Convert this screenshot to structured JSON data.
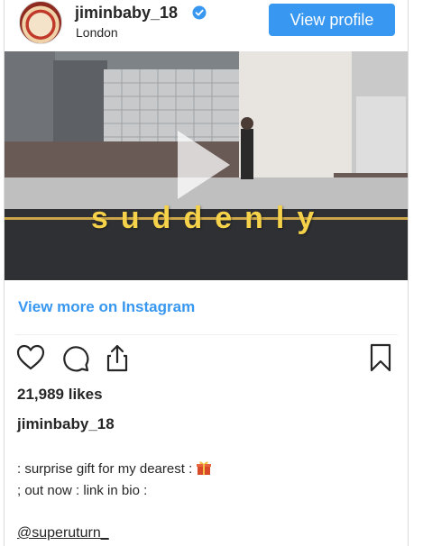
{
  "header": {
    "username": "jiminbaby_18",
    "location": "London",
    "view_profile_label": "View profile"
  },
  "media": {
    "overlay_text": "suddenly"
  },
  "view_more_label": "View more on Instagram",
  "likes": "21,989 likes",
  "post": {
    "author": "jiminbaby_18",
    "caption_line1": ": surprise gift for my dearest :",
    "caption_line2": "; out now : link in bio :",
    "mention": "@superuturn_"
  },
  "colors": {
    "accent": "#3897f0",
    "verified": "#3897f0"
  },
  "icons": [
    "heart-icon",
    "comment-icon",
    "share-icon",
    "bookmark-icon",
    "verified-icon",
    "play-icon",
    "gift-emoji"
  ]
}
